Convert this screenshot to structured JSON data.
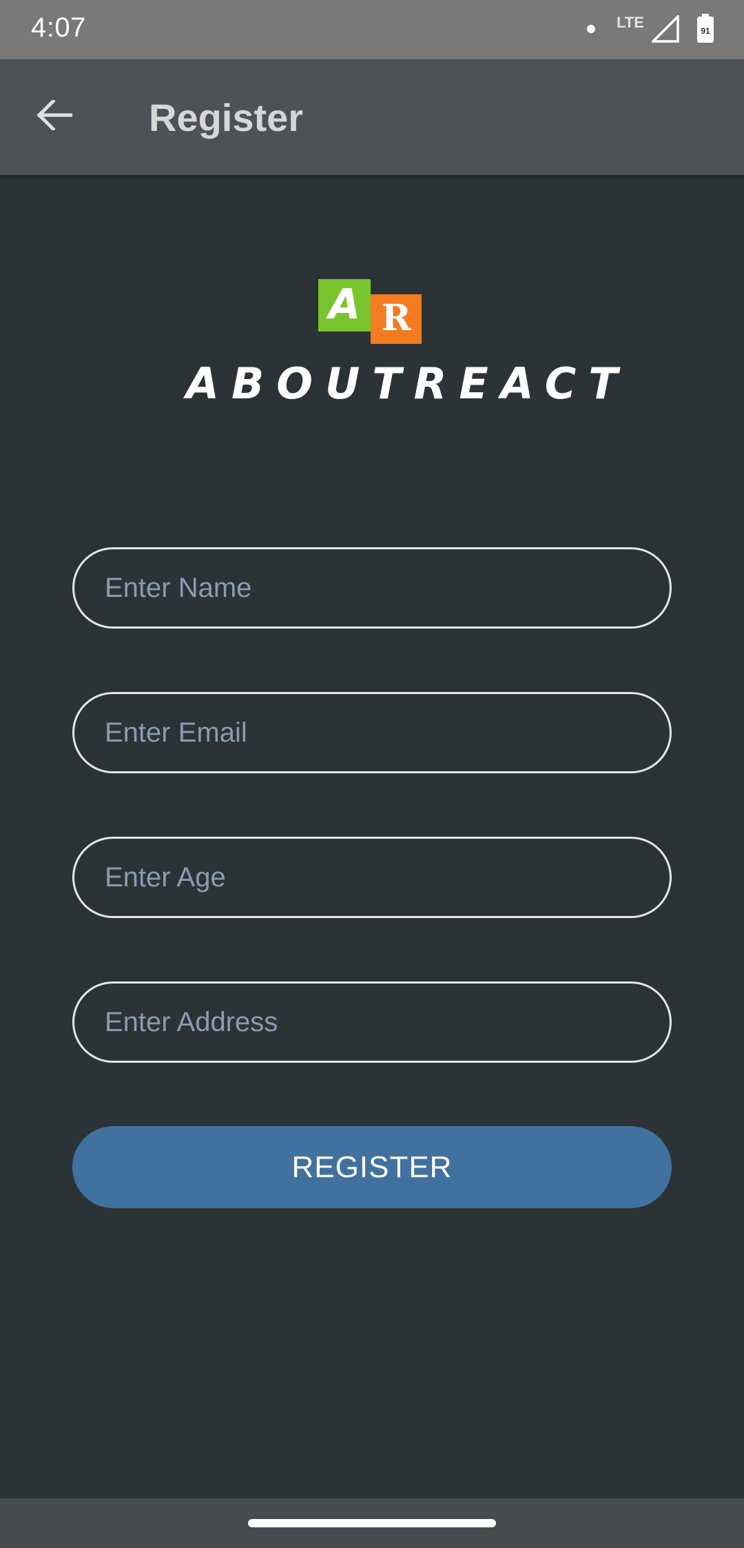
{
  "status_bar": {
    "time": "4:07",
    "network": "LTE",
    "battery_level": "91",
    "icons": [
      "notification-dot-icon",
      "signal-icon",
      "battery-icon"
    ]
  },
  "app_bar": {
    "title": "Register",
    "back_icon": "arrow-back-icon"
  },
  "logo": {
    "tile_a": "A",
    "tile_r": "R",
    "wordmark": "ABOUTREACT",
    "colors": {
      "green": "#7ac52d",
      "orange": "#f47b20"
    }
  },
  "form": {
    "name_placeholder": "Enter Name",
    "email_placeholder": "Enter Email",
    "age_placeholder": "Enter Age",
    "address_placeholder": "Enter Address",
    "submit_label": "REGISTER"
  },
  "theme": {
    "background": "#2c3336",
    "app_bar": "#4c5255",
    "status_bar": "#797979",
    "button": "#41729f",
    "placeholder": "#8b9bb3"
  }
}
